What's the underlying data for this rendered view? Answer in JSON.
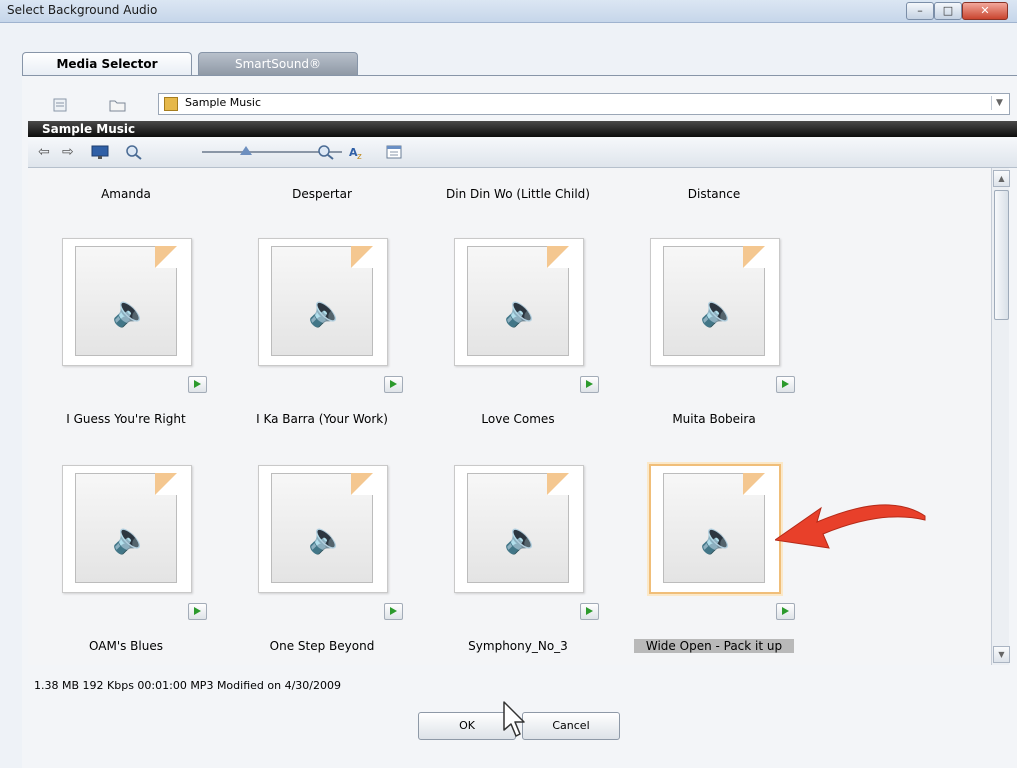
{
  "window": {
    "title": "Select Background Audio",
    "min_glyph": "–",
    "max_glyph": "□",
    "close_glyph": "✕"
  },
  "tabs": [
    {
      "label": "Media Selector",
      "active": true
    },
    {
      "label": "SmartSound®",
      "active": false
    }
  ],
  "path": {
    "value": "Sample Music"
  },
  "section_header": "Sample Music",
  "top_row_labels": [
    "Amanda",
    "Despertar",
    "Din Din Wo (Little Child)",
    "Distance"
  ],
  "rows": [
    {
      "labels": [
        "I Guess You're Right",
        "I Ka Barra (Your Work)",
        "Love Comes",
        "Muita Bobeira"
      ]
    },
    {
      "labels": [
        "OAM's Blues",
        "One Step Beyond",
        "Symphony_No_3",
        "Wide Open - Pack it up"
      ]
    }
  ],
  "selected": "Wide Open - Pack it up",
  "status": "1.38 MB  192 Kbps 00:01:00 MP3  Modified on 4/30/2009",
  "buttons": {
    "ok": "OK",
    "cancel": "Cancel"
  },
  "colors": {
    "header_bg": "#1a1a1a",
    "play_green": "#2c9a2c",
    "selection_border": "#f0be79",
    "arrow_red": "#e8402a"
  }
}
